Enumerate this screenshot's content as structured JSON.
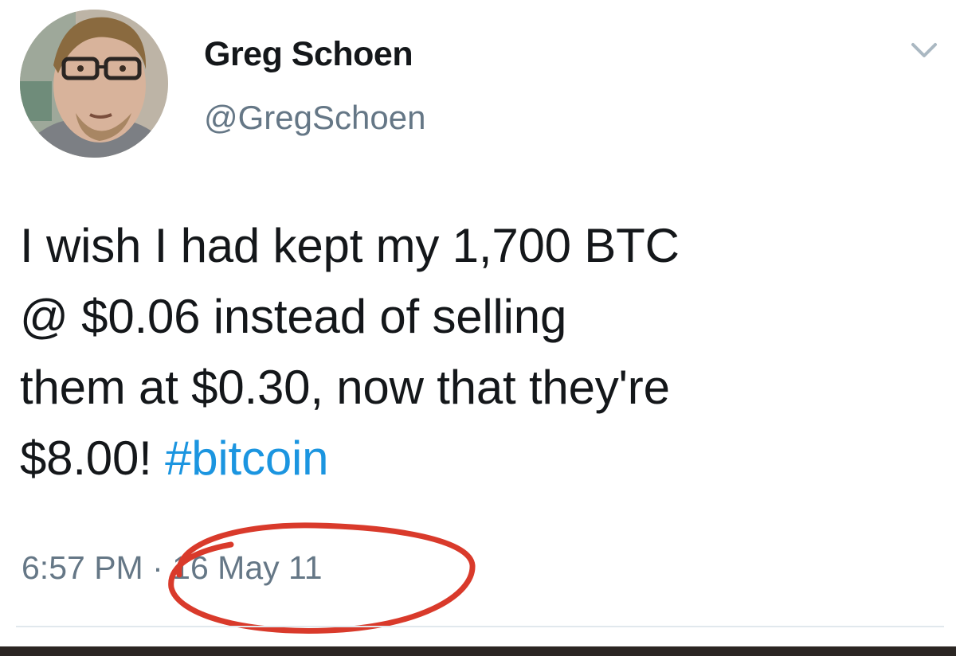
{
  "user": {
    "display_name": "Greg Schoen",
    "handle": "@GregSchoen",
    "avatar_icon": "profile-photo"
  },
  "menu": {
    "icon": "chevron-down-icon"
  },
  "tweet": {
    "lines": [
      "I wish I had kept my 1,700 BTC",
      "@ $0.06 instead of selling",
      "them at $0.30, now that they're",
      "$8.00! "
    ],
    "hashtag": "#bitcoin",
    "time": "6:57 PM",
    "separator": "·",
    "date": "16 May 11"
  },
  "colors": {
    "hashtag": "#1b95e0",
    "secondary_text": "#657786",
    "annotation": "#d93a2b"
  }
}
